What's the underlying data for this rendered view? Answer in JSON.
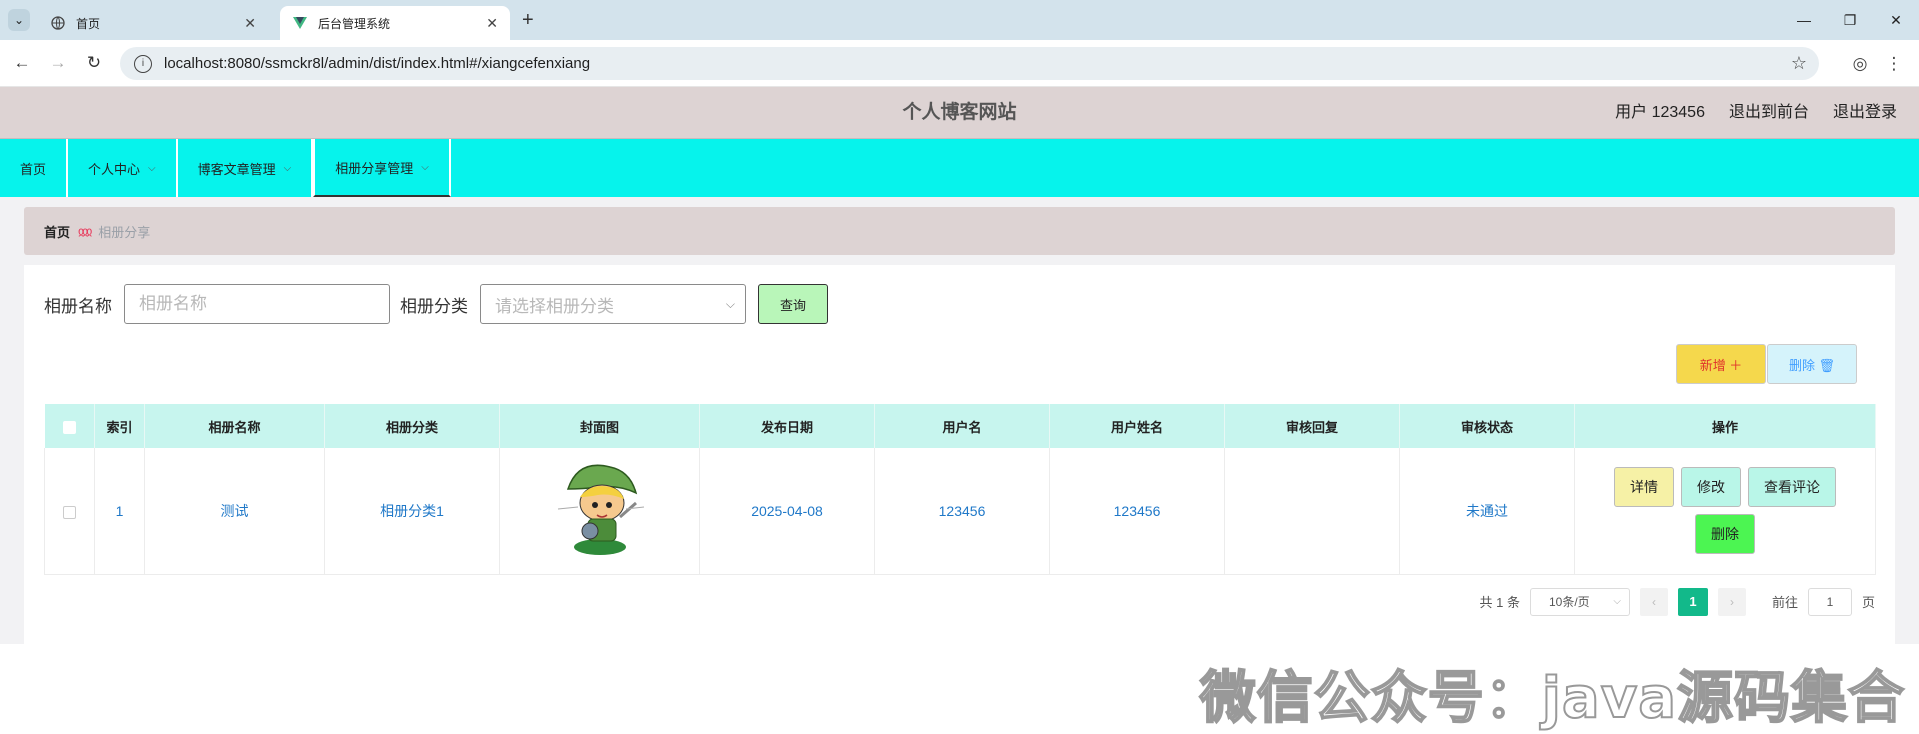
{
  "browser": {
    "tabs": [
      {
        "title": "首页",
        "active": false
      },
      {
        "title": "后台管理系统",
        "active": true
      }
    ],
    "url": "localhost:8080/ssmckr8l/admin/dist/index.html#/xiangcefenxiang"
  },
  "header": {
    "site_title": "个人博客网站",
    "user_label": "用户 123456",
    "exit_front": "退出到前台",
    "logout": "退出登录"
  },
  "menu": [
    {
      "label": "首页",
      "has_dropdown": false
    },
    {
      "label": "个人中心",
      "has_dropdown": true
    },
    {
      "label": "博客文章管理",
      "has_dropdown": true
    },
    {
      "label": "相册分享管理",
      "has_dropdown": true,
      "active": true
    }
  ],
  "breadcrumb": {
    "home": "首页",
    "current": "相册分享"
  },
  "search": {
    "name_label": "相册名称",
    "name_placeholder": "相册名称",
    "category_label": "相册分类",
    "category_placeholder": "请选择相册分类",
    "query_button": "查询"
  },
  "actions": {
    "add_button": "新增 ＋",
    "delete_button": "删除 🗑"
  },
  "table": {
    "columns": [
      "索引",
      "相册名称",
      "相册分类",
      "封面图",
      "发布日期",
      "用户名",
      "用户姓名",
      "审核回复",
      "审核状态",
      "操作"
    ],
    "rows": [
      {
        "index": "1",
        "name": "测试",
        "category": "相册分类1",
        "date": "2025-04-08",
        "username": "123456",
        "user_realname": "123456",
        "review_reply": "",
        "review_status": "未通过"
      }
    ],
    "row_actions": {
      "detail": "详情",
      "edit": "修改",
      "comments": "查看评论",
      "delete": "删除"
    }
  },
  "pagination": {
    "total": "共 1 条",
    "page_size": "10条/页",
    "current_page": "1",
    "goto_label": "前往",
    "goto_value": "1",
    "page_suffix": "页"
  },
  "watermark": "微信公众号：java源码集合",
  "colors": {
    "menu_bg": "#06f3ec",
    "header_bg": "#ddd3d3",
    "table_header_bg": "#c7f5ee",
    "pager_active": "#12b98a"
  }
}
